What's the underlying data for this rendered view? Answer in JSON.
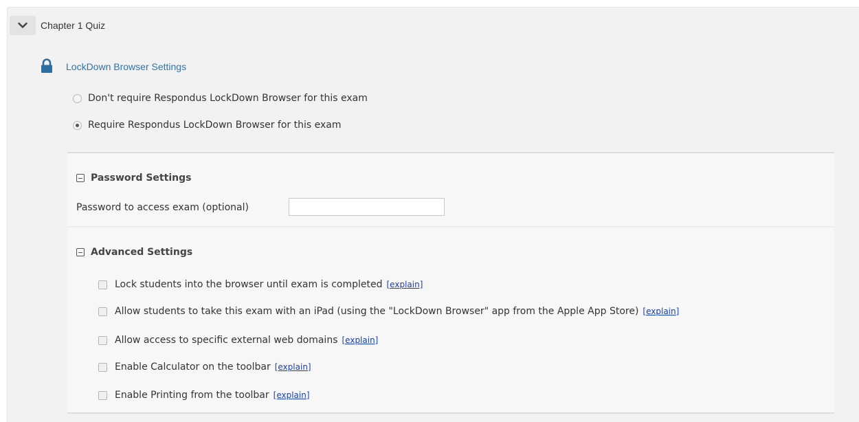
{
  "quiz": {
    "title": "Chapter 1 Quiz"
  },
  "lockdown": {
    "link_label": "LockDown Browser Settings",
    "options": [
      {
        "label": "Don't require Respondus LockDown Browser for this exam",
        "selected": false
      },
      {
        "label": "Require Respondus LockDown Browser for this exam",
        "selected": true
      }
    ]
  },
  "password_settings": {
    "title": "Password Settings",
    "field_label": "Password to access exam (optional)",
    "field_value": ""
  },
  "advanced_settings": {
    "title": "Advanced Settings",
    "explain_label": "[explain]",
    "items": [
      {
        "label": "Lock students into the browser until exam is completed",
        "checked": false
      },
      {
        "label": "Allow students to take this exam with an iPad (using the \"LockDown Browser\" app from the Apple App Store)",
        "checked": false
      },
      {
        "label": "Allow access to specific external web domains",
        "checked": false
      },
      {
        "label": "Enable Calculator on the toolbar",
        "checked": false
      },
      {
        "label": "Enable Printing from the toolbar",
        "checked": false
      }
    ]
  },
  "colors": {
    "link": "#2d75a8",
    "explain_link": "#1a3fa6",
    "lock_icon": "#2d6fa3"
  },
  "icons": {
    "collapse": "chevron-down-icon",
    "lock": "lock-icon",
    "section_toggle": "minus-box-icon"
  }
}
